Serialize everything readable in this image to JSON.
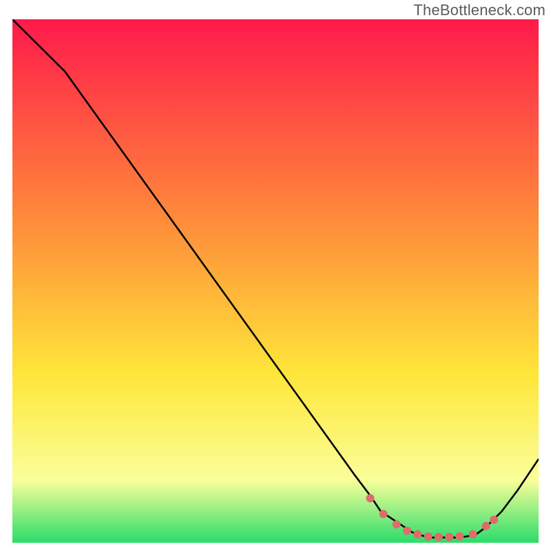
{
  "watermark": "TheBottleneck.com",
  "chart_data": {
    "type": "line",
    "title": "",
    "xlabel": "",
    "ylabel": "",
    "xlim": [
      0,
      100
    ],
    "ylim": [
      0,
      100
    ],
    "grid": false,
    "background_gradient": {
      "top": "#ff1a4b",
      "mid1": "#ff8a3a",
      "mid2": "#ffe63a",
      "mid3": "#faff9a",
      "bottom": "#2bdc6a"
    },
    "series": [
      {
        "name": "bottleneck-curve",
        "color": "#000000",
        "x": [
          0,
          5,
          10,
          15,
          20,
          25,
          30,
          35,
          40,
          45,
          50,
          55,
          60,
          65,
          68,
          70,
          73,
          76,
          79,
          82,
          85,
          88,
          90,
          93,
          96,
          100
        ],
        "y": [
          100,
          95,
          90,
          83,
          76,
          69,
          62,
          55,
          48,
          41,
          34,
          27,
          20,
          13,
          9,
          6,
          4,
          2,
          1,
          1,
          1,
          1.5,
          3,
          6,
          10,
          16
        ]
      }
    ],
    "markers": {
      "name": "marker-dots",
      "color": "#e06b6b",
      "radius": 6,
      "x": [
        68,
        70.5,
        73,
        75,
        77,
        79,
        81,
        83,
        85,
        87.5,
        90,
        91.5
      ],
      "y": [
        8.5,
        5.5,
        3.5,
        2.3,
        1.6,
        1.2,
        1.1,
        1.1,
        1.2,
        1.6,
        3.2,
        4.4
      ]
    }
  }
}
